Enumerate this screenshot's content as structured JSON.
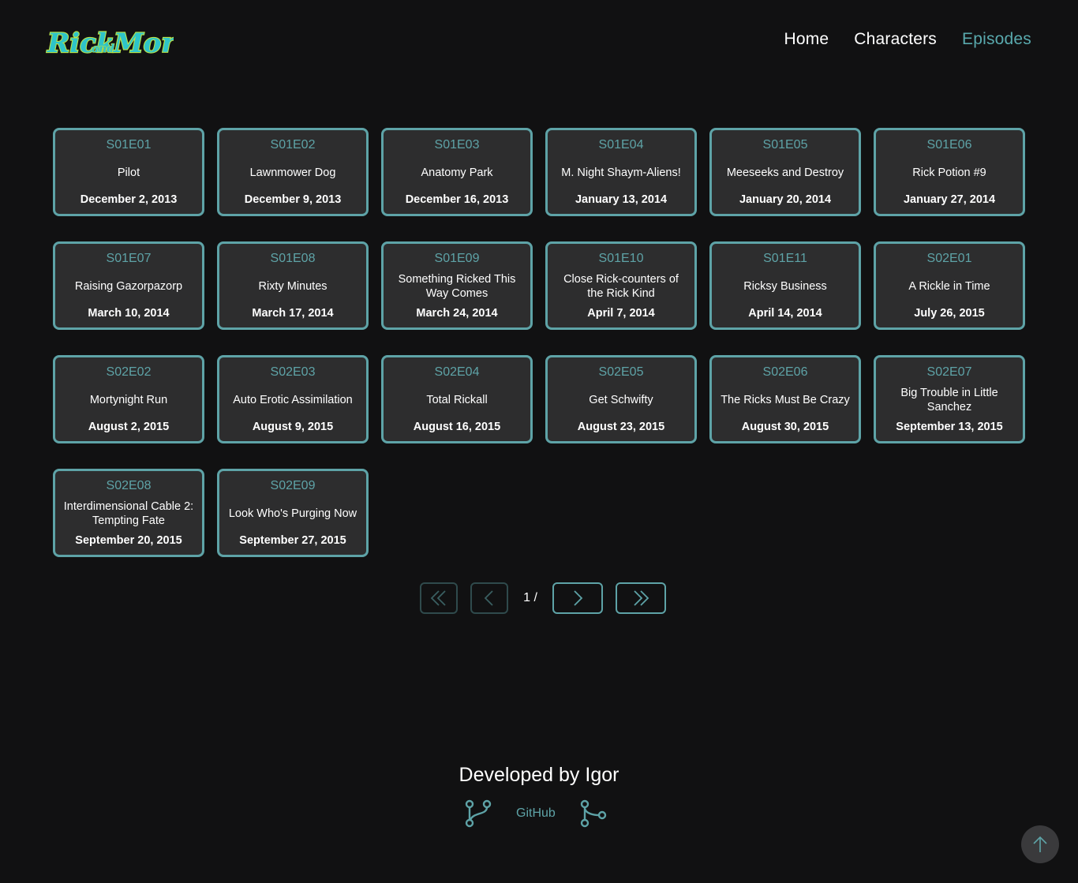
{
  "brand": {
    "logo_text": "Rick and Morty",
    "logo_color": "#2ec4c9",
    "logo_outline": "#b7e34a"
  },
  "nav": {
    "home": "Home",
    "characters": "Characters",
    "episodes": "Episodes",
    "active": "episodes",
    "accent_color": "#59a9ad"
  },
  "episodes": [
    {
      "code": "S01E01",
      "name": "Pilot",
      "date": "December 2, 2013"
    },
    {
      "code": "S01E02",
      "name": "Lawnmower Dog",
      "date": "December 9, 2013"
    },
    {
      "code": "S01E03",
      "name": "Anatomy Park",
      "date": "December 16, 2013"
    },
    {
      "code": "S01E04",
      "name": "M. Night Shaym-Aliens!",
      "date": "January 13, 2014"
    },
    {
      "code": "S01E05",
      "name": "Meeseeks and Destroy",
      "date": "January 20, 2014"
    },
    {
      "code": "S01E06",
      "name": "Rick Potion #9",
      "date": "January 27, 2014"
    },
    {
      "code": "S01E07",
      "name": "Raising Gazorpazorp",
      "date": "March 10, 2014"
    },
    {
      "code": "S01E08",
      "name": "Rixty Minutes",
      "date": "March 17, 2014"
    },
    {
      "code": "S01E09",
      "name": "Something Ricked This Way Comes",
      "date": "March 24, 2014"
    },
    {
      "code": "S01E10",
      "name": "Close Rick-counters of the Rick Kind",
      "date": "April 7, 2014"
    },
    {
      "code": "S01E11",
      "name": "Ricksy Business",
      "date": "April 14, 2014"
    },
    {
      "code": "S02E01",
      "name": "A Rickle in Time",
      "date": "July 26, 2015"
    },
    {
      "code": "S02E02",
      "name": "Mortynight Run",
      "date": "August 2, 2015"
    },
    {
      "code": "S02E03",
      "name": "Auto Erotic Assimilation",
      "date": "August 9, 2015"
    },
    {
      "code": "S02E04",
      "name": "Total Rickall",
      "date": "August 16, 2015"
    },
    {
      "code": "S02E05",
      "name": "Get Schwifty",
      "date": "August 23, 2015"
    },
    {
      "code": "S02E06",
      "name": "The Ricks Must Be Crazy",
      "date": "August 30, 2015"
    },
    {
      "code": "S02E07",
      "name": "Big Trouble in Little Sanchez",
      "date": "September 13, 2015"
    },
    {
      "code": "S02E08",
      "name": "Interdimensional Cable 2: Tempting Fate",
      "date": "September 20, 2015"
    },
    {
      "code": "S02E09",
      "name": "Look Who's Purging Now",
      "date": "September 27, 2015"
    }
  ],
  "pagination": {
    "page_label": "1 /",
    "first_icon": "double-chevron-left-icon",
    "prev_icon": "chevron-left-icon",
    "next_icon": "chevron-right-icon",
    "last_icon": "double-chevron-right-icon",
    "first_disabled": true,
    "prev_disabled": true
  },
  "footer": {
    "title": "Developed by Igor",
    "github_label": "GitHub",
    "left_icon": "git-branch-icon",
    "right_icon": "git-fork-icon"
  },
  "back_to_top_icon": "arrow-up-icon",
  "colors": {
    "background": "#111112",
    "card_bg": "#2d2d2e",
    "card_border": "#5ea3a7"
  }
}
